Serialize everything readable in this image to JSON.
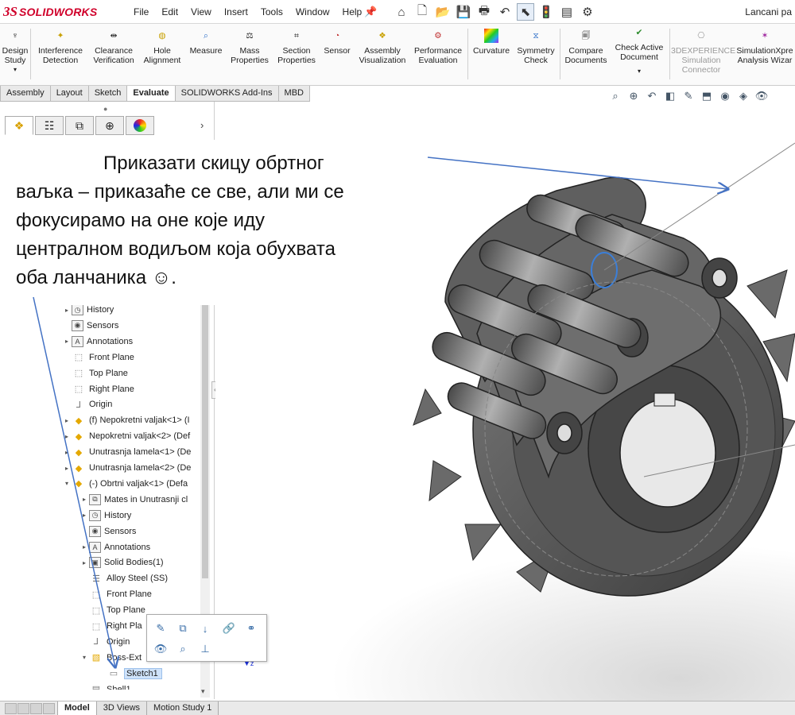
{
  "app": {
    "logo_prefix": "3S",
    "logo_text": "SOLIDWORKS",
    "document_title": "Lancani pa"
  },
  "menu": [
    "File",
    "Edit",
    "View",
    "Insert",
    "Tools",
    "Window",
    "Help"
  ],
  "quick_access_icons": [
    "home-icon",
    "new-document-icon",
    "open-icon",
    "save-icon",
    "print-icon",
    "undo-icon",
    "select-icon",
    "rebuild-icon",
    "file-properties-icon",
    "options-icon"
  ],
  "ribbon": {
    "design_study": [
      "Design",
      "Study"
    ],
    "interference": [
      "Interference",
      "Detection"
    ],
    "clearance": [
      "Clearance",
      "Verification"
    ],
    "hole_alignment": [
      "Hole",
      "Alignment"
    ],
    "measure": [
      "Measure"
    ],
    "mass_properties": [
      "Mass",
      "Properties"
    ],
    "section_properties": [
      "Section",
      "Properties"
    ],
    "sensor": [
      "Sensor"
    ],
    "assembly_visualization": [
      "Assembly",
      "Visualization"
    ],
    "performance_evaluation": [
      "Performance",
      "Evaluation"
    ],
    "curvature": [
      "Curvature"
    ],
    "symmetry_check": [
      "Symmetry",
      "Check"
    ],
    "compare_documents": [
      "Compare",
      "Documents"
    ],
    "check_active_document": [
      "Check Active",
      "Document"
    ],
    "experience_connector": [
      "3DEXPERIENCE",
      "Simulation",
      "Connector"
    ],
    "simulationxpress": [
      "SimulationXpre",
      "Analysis Wizar"
    ]
  },
  "command_tabs": [
    {
      "label": "Assembly",
      "active": false
    },
    {
      "label": "Layout",
      "active": false
    },
    {
      "label": "Sketch",
      "active": false
    },
    {
      "label": "Evaluate",
      "active": true
    },
    {
      "label": "SOLIDWORKS Add-Ins",
      "active": false
    },
    {
      "label": "MBD",
      "active": false
    }
  ],
  "tree": [
    {
      "label": "History",
      "indent": 0,
      "arrow": "▸",
      "icon": "history-icon",
      "glyph": "◷",
      "kind": "boxed"
    },
    {
      "label": "Sensors",
      "indent": 0,
      "arrow": "",
      "icon": "sensors-icon",
      "glyph": "◉",
      "kind": "boxed"
    },
    {
      "label": "Annotations",
      "indent": 0,
      "arrow": "▸",
      "icon": "annotations-icon",
      "glyph": "A",
      "kind": "boxed"
    },
    {
      "label": "Front Plane",
      "indent": 0,
      "arrow": "",
      "icon": "plane-icon",
      "glyph": "⬚",
      "kind": "plane"
    },
    {
      "label": "Top Plane",
      "indent": 0,
      "arrow": "",
      "icon": "plane-icon",
      "glyph": "⬚",
      "kind": "plane"
    },
    {
      "label": "Right Plane",
      "indent": 0,
      "arrow": "",
      "icon": "plane-icon",
      "glyph": "⬚",
      "kind": "plane"
    },
    {
      "label": "Origin",
      "indent": 0,
      "arrow": "",
      "icon": "origin-icon",
      "glyph": "⅃",
      "kind": "plane"
    },
    {
      "label": "(f) Nepokretni valjak<1> (I",
      "indent": 0,
      "arrow": "▸",
      "icon": "part-icon",
      "glyph": "◆",
      "kind": "part"
    },
    {
      "label": "Nepokretni valjak<2> (Def",
      "indent": 0,
      "arrow": "▸",
      "icon": "part-icon",
      "glyph": "◆",
      "kind": "part"
    },
    {
      "label": "Unutrasnja lamela<1> (De",
      "indent": 0,
      "arrow": "▸",
      "icon": "part-icon",
      "glyph": "◆",
      "kind": "part"
    },
    {
      "label": "Unutrasnja lamela<2> (De",
      "indent": 0,
      "arrow": "▸",
      "icon": "part-icon",
      "glyph": "◆",
      "kind": "part"
    },
    {
      "label": "(-) Obrtni valjak<1> (Defa",
      "indent": 0,
      "arrow": "▾",
      "icon": "part-icon",
      "glyph": "◆",
      "kind": "part"
    },
    {
      "label": "Mates in Unutrasnji cl",
      "indent": 1,
      "arrow": "▸",
      "icon": "mates-icon",
      "glyph": "⧉",
      "kind": "boxed"
    },
    {
      "label": "History",
      "indent": 1,
      "arrow": "▸",
      "icon": "history-icon",
      "glyph": "◷",
      "kind": "boxed"
    },
    {
      "label": "Sensors",
      "indent": 1,
      "arrow": "",
      "icon": "sensors-icon",
      "glyph": "◉",
      "kind": "boxed"
    },
    {
      "label": "Annotations",
      "indent": 1,
      "arrow": "▸",
      "icon": "annotations-icon",
      "glyph": "A",
      "kind": "boxed"
    },
    {
      "label": "Solid Bodies(1)",
      "indent": 1,
      "arrow": "▸",
      "icon": "solid-bodies-icon",
      "glyph": "▣",
      "kind": "boxed"
    },
    {
      "label": "Alloy Steel (SS)",
      "indent": 1,
      "arrow": "",
      "icon": "material-icon",
      "glyph": "☰",
      "kind": "plane"
    },
    {
      "label": "Front Plane",
      "indent": 1,
      "arrow": "",
      "icon": "plane-icon",
      "glyph": "⬚",
      "kind": "plane"
    },
    {
      "label": "Top Plane",
      "indent": 1,
      "arrow": "",
      "icon": "plane-icon",
      "glyph": "⬚",
      "kind": "plane"
    },
    {
      "label": "Right Pla",
      "indent": 1,
      "arrow": "",
      "icon": "plane-icon",
      "glyph": "⬚",
      "kind": "plane"
    },
    {
      "label": "Origin",
      "indent": 1,
      "arrow": "",
      "icon": "origin-icon",
      "glyph": "⅃",
      "kind": "plane"
    },
    {
      "label": "Boss-Ext",
      "indent": 1,
      "arrow": "▾",
      "icon": "extrude-icon",
      "glyph": "▧",
      "kind": "part"
    },
    {
      "label": "Sketch1",
      "indent": 2,
      "arrow": "",
      "icon": "sketch-icon",
      "glyph": "▭",
      "kind": "plane",
      "selected": true
    },
    {
      "label": "Shell1",
      "indent": 1,
      "arrow": "",
      "icon": "shell-icon",
      "glyph": "▤",
      "kind": "plane"
    }
  ],
  "bottom_tabs": [
    {
      "label": "Model",
      "active": true
    },
    {
      "label": "3D Views",
      "active": false
    },
    {
      "label": "Motion Study 1",
      "active": false
    }
  ],
  "annotation": {
    "line1": "Приказати скицу обртног",
    "line2": "ваљка – приказаће се све, али ми се",
    "line3": "фокусирамо на оне које иду",
    "line4": "централном водиљом која обухвата",
    "line5": "оба ланчаника ☺."
  },
  "colors": {
    "brand": "#d0002a",
    "selection": "#cfe3fb",
    "arrow": "#4472c4"
  }
}
